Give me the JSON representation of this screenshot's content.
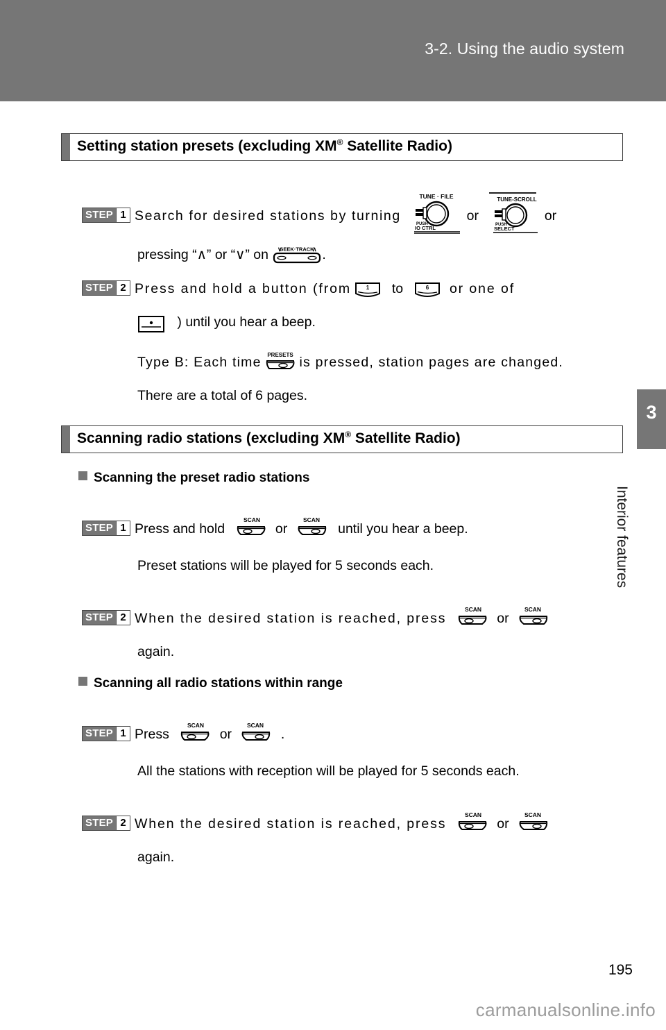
{
  "header": {
    "title": "3-2. Using the audio system"
  },
  "chapter_tab": {
    "number": "3",
    "name": "Interior features"
  },
  "sections": [
    {
      "id": "setting-presets",
      "title_before": "Setting station presets (excluding XM",
      "title_sup": "®",
      "title_after": " Satellite Radio)"
    },
    {
      "id": "scanning-stations",
      "title_before": "Scanning radio stations (excluding XM",
      "title_sup": "®",
      "title_after": " Satellite Radio)"
    }
  ],
  "step_badge": {
    "word": "STEP",
    "num1": "1",
    "num2": "2"
  },
  "presets_block": {
    "step1_text_a": "Search for desired stations by turning",
    "step1_or1": "or",
    "step1_or2": "or",
    "step1_line2_a": "pressing “",
    "step1_line2_up": "∧",
    "step1_line2_b": "” or “",
    "step1_line2_down": "∨",
    "step1_line2_c": "” on",
    "step1_line2_d": ".",
    "step2_text_a": "Press and hold a button (from",
    "step2_to": "to",
    "step2_text_b": "or one of",
    "step2_line2_a": ") until you hear a beep.",
    "note_a": "Type B: Each time",
    "note_b": "is pressed, station pages are changed.",
    "note_line2": "There are a total of 6 pages."
  },
  "scanning_block": {
    "sub1": "Scanning the preset radio stations",
    "sub2": "Scanning all radio stations within range",
    "p1_step1_a": "Press and hold",
    "p1_step1_or": "or",
    "p1_step1_b": "until you hear a beep.",
    "p1_note": "Preset stations will be played for 5 seconds each.",
    "p1_step2_a": "When the desired station is reached, press",
    "p1_step2_or": "or",
    "p1_step2_line2": "again.",
    "p2_step1_a": "Press",
    "p2_step1_or": "or",
    "p2_step1_b": ".",
    "p2_note": "All the stations with reception will be played for 5 seconds each.",
    "p2_step2_a": "When the desired station is reached, press",
    "p2_step2_or": "or",
    "p2_step2_line2": "again."
  },
  "icons": {
    "dial_tune_file_label": "TUNE · FILE",
    "dial_tune_file_push": "PUSH",
    "dial_tune_file_fn": "IO CTRL",
    "dial_tune_scroll_label": "TUNE-SCROLL",
    "dial_tune_scroll_push": "PUSH",
    "dial_tune_scroll_fn": "SELECT",
    "seek_track_label": "SEEK·TRACK",
    "seek_up": "∧",
    "seek_down": "∨",
    "scan_label": "SCAN",
    "presets_label": "PRESETS",
    "preset_1": "1",
    "preset_6": "6",
    "preset_small": "○"
  },
  "footer": {
    "page_number": "195",
    "watermark": "carmanualsonline.info"
  },
  "colors": {
    "header_gray": "#767676",
    "tab_gray": "#767676",
    "watermark_gray": "#9c9c9c",
    "text_black": "#000000"
  }
}
